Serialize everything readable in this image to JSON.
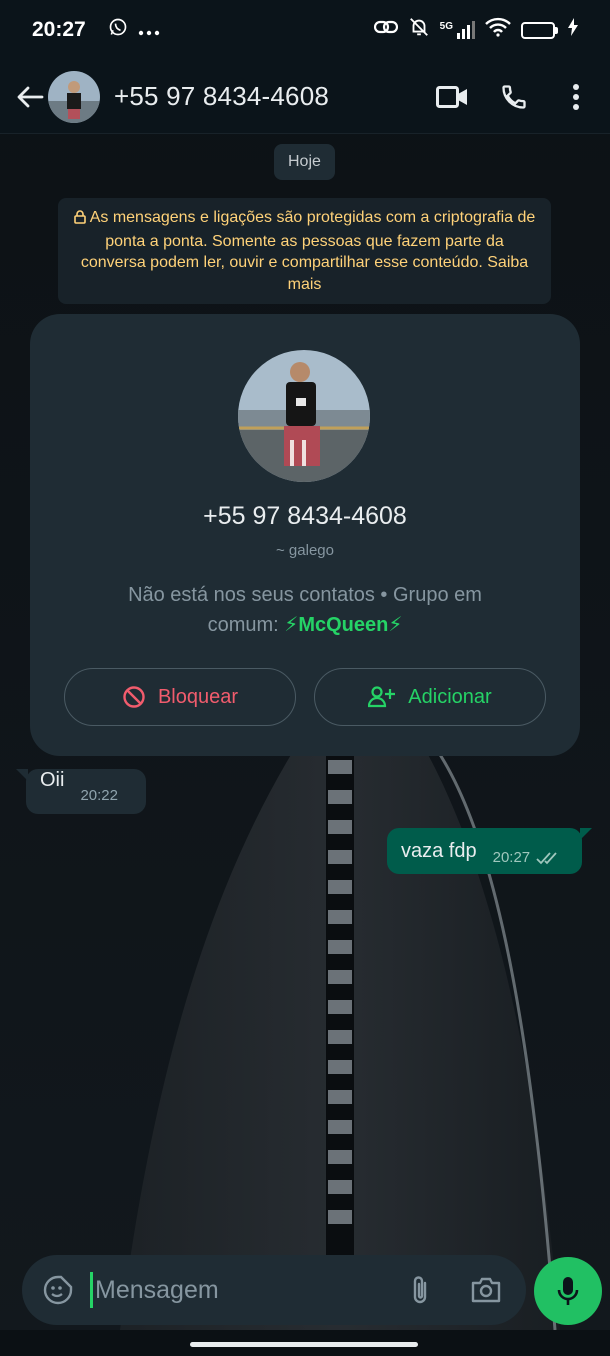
{
  "status_bar": {
    "time": "20:27",
    "battery": "23",
    "battery_level": 0.23,
    "network": "5G",
    "icons": [
      "whatsapp-icon",
      "more-dots-icon",
      "link-icon",
      "bell-muted-icon",
      "signal-icon",
      "wifi-icon",
      "battery-icon",
      "charging-icon"
    ]
  },
  "header": {
    "title": "+55 97 8434-4608",
    "icons": [
      "back-arrow-icon",
      "video-call-icon",
      "phone-call-icon",
      "more-vert-icon"
    ]
  },
  "chat": {
    "date_chip": "Hoje",
    "encryption_notice": "As mensagens e ligações são protegidas com a criptografia de ponta a ponta. Somente as pessoas que fazem parte da conversa podem ler, ouvir e compartilhar esse conteúdo. Saiba mais"
  },
  "contact_card": {
    "phone": "+55 97 8434-4608",
    "nickname": "~ galego",
    "info_prefix": "Não está nos seus contatos  •  Grupo em comum: ",
    "group_name": "⚡McQueen⚡",
    "block_label": "Bloquear",
    "add_label": "Adicionar"
  },
  "messages": [
    {
      "direction": "incoming",
      "text": "Oii",
      "time": "20:22"
    },
    {
      "direction": "outgoing",
      "text": "vaza fdp",
      "time": "20:27",
      "status": "read"
    }
  ],
  "composer": {
    "placeholder": "Mensagem",
    "icons": [
      "sticker-icon",
      "paperclip-icon",
      "camera-icon",
      "mic-icon"
    ]
  },
  "colors": {
    "accent": "#25d366",
    "outgoing_bubble": "#005c4b",
    "incoming_bubble": "#1f2c34",
    "notice_text": "#ffd279",
    "block_red": "#f15c6d"
  }
}
